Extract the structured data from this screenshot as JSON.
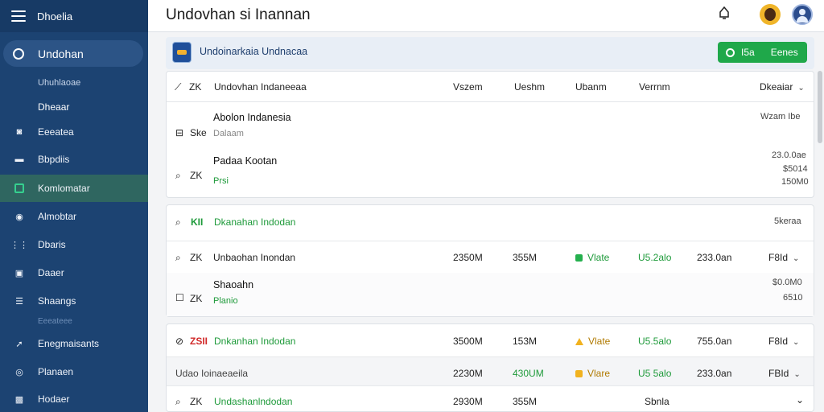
{
  "sidebar": {
    "brand": "Dhoelia",
    "active": "Undohan",
    "sub1": "Uhuhlaoae",
    "sub2": "Dheaar",
    "items": [
      "Eeeatea",
      "Bbpdiis",
      "Komlomatar",
      "Almobtar",
      "Dbaris",
      "Daaer",
      "Shaangs"
    ],
    "separator": "Eeeateee",
    "items2": [
      "Enegmaisants",
      "Planaen",
      "Hodaer"
    ]
  },
  "header": {
    "title": "Undovhan si Inannan"
  },
  "banner": {
    "text": "Undoinarkaia Undnacaa",
    "btn_a": "I5a",
    "btn_b": "Eenes"
  },
  "table": {
    "headers": [
      "ZK",
      "Undovhan Indaneeaa",
      "Vszem",
      "Ueshm",
      "Ubanm",
      "Verrnm",
      "Dkeaiar"
    ],
    "r1": {
      "name": "Abolon Indanesia",
      "sub": "Dalaam",
      "right": "Wzam Ibe",
      "code": "Ske"
    },
    "r2": {
      "name": "Padaa Kootan",
      "sub": "Prsi",
      "code": "ZK",
      "v1": "23.0.0ae",
      "v2": "$5014",
      "v3": "150M0"
    }
  },
  "group2": {
    "code": "KII",
    "title": "Dkanahan Indodan",
    "right": "5keraa",
    "row1": {
      "code": "ZK",
      "name": "Unbaohan Inondan",
      "a": "2350M",
      "b": "355M",
      "status": "Vlate",
      "d": "U5.2alo",
      "e": "233.0an",
      "f": "F8Id"
    },
    "row2": {
      "name": "Shaoahn",
      "sub": "Planio",
      "code": "ZK",
      "v1": "$0.0M0",
      "v2": "6510"
    }
  },
  "group3": {
    "row1": {
      "code": "ZSII",
      "name": "Dnkanhan Indodan",
      "a": "3500M",
      "b": "153M",
      "status": "Vlate",
      "d": "U5.5alo",
      "e": "755.0an",
      "f": "F8Id"
    },
    "row2": {
      "name": "Udao Ioinaeaeila",
      "a": "2230M",
      "b": "430UM",
      "status": "Vlare",
      "d": "U5 5alo",
      "e": "233.0an",
      "f": "FBId"
    },
    "row3": {
      "code": "ZK",
      "name": "Undashanlndodan",
      "a": "2930M",
      "b": "355M",
      "d": "Sbnla"
    }
  }
}
